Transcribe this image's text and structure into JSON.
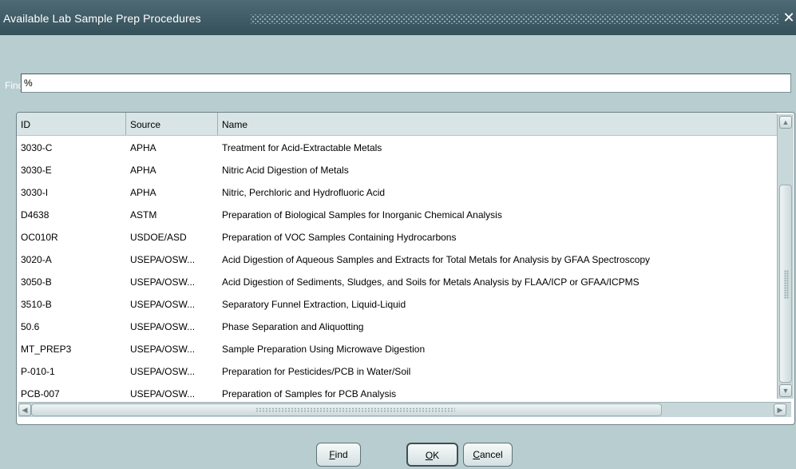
{
  "window": {
    "title": "Available Lab Sample Prep Procedures",
    "close_glyph": "✕"
  },
  "search": {
    "label": "Find",
    "value": "%"
  },
  "table": {
    "columns": [
      "ID",
      "Source",
      "Name"
    ],
    "rows": [
      {
        "id": "3030-C",
        "source": "APHA",
        "name": "Treatment for Acid-Extractable Metals"
      },
      {
        "id": "3030-E",
        "source": "APHA",
        "name": "Nitric Acid Digestion of Metals"
      },
      {
        "id": "3030-I",
        "source": "APHA",
        "name": "Nitric, Perchloric and Hydrofluoric Acid"
      },
      {
        "id": "D4638",
        "source": "ASTM",
        "name": "Preparation of Biological Samples for Inorganic Chemical Analysis"
      },
      {
        "id": "OC010R",
        "source": "USDOE/ASD",
        "name": "Preparation of VOC Samples Containing Hydrocarbons"
      },
      {
        "id": "3020-A",
        "source": "USEPA/OSW...",
        "name": "Acid Digestion of Aqueous Samples and Extracts for Total Metals for Analysis by GFAA Spectroscopy"
      },
      {
        "id": "3050-B",
        "source": "USEPA/OSW...",
        "name": "Acid Digestion of Sediments, Sludges, and Soils for Metals Analysis by FLAA/ICP or GFAA/ICPMS"
      },
      {
        "id": "3510-B",
        "source": "USEPA/OSW...",
        "name": "Separatory Funnel Extraction, Liquid-Liquid"
      },
      {
        "id": "50.6",
        "source": "USEPA/OSW...",
        "name": "Phase Separation and Aliquotting"
      },
      {
        "id": "MT_PREP3",
        "source": "USEPA/OSW...",
        "name": "Sample Preparation Using Microwave Digestion"
      },
      {
        "id": "P-010-1",
        "source": "USEPA/OSW...",
        "name": "Preparation for Pesticides/PCB in Water/Soil"
      },
      {
        "id": "PCB-007",
        "source": "USEPA/OSW...",
        "name": "Preparation of Samples for PCB Analysis"
      }
    ]
  },
  "scrollbars": {
    "up_glyph": "▲",
    "down_glyph": "▼",
    "left_glyph": "◀",
    "right_glyph": "▶"
  },
  "buttons": {
    "find": {
      "mnemonic": "F",
      "rest": "ind"
    },
    "ok": {
      "mnemonic": "O",
      "rest": "K"
    },
    "cancel": {
      "mnemonic": "C",
      "rest": "ancel"
    }
  },
  "colors": {
    "titlebar": "#34505b",
    "dialog_background": "#b8cdd0",
    "grid_header": "#d8e4e6"
  }
}
